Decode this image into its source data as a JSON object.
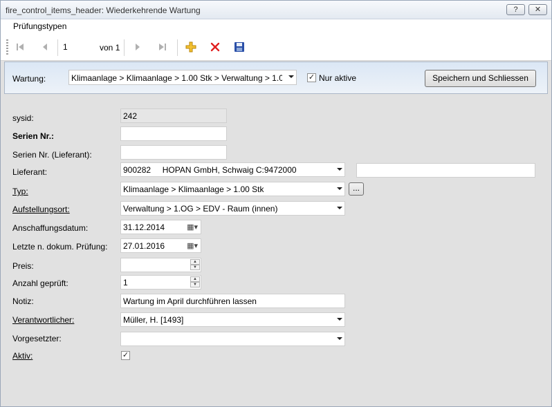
{
  "window": {
    "title": "fire_control_items_header: Wiederkehrende Wartung",
    "help_label": "?",
    "close_label": "✕"
  },
  "menu": {
    "items": [
      "Prüfungstypen"
    ]
  },
  "toolbar": {
    "page_value": "1",
    "of_label": "von",
    "total_pages": "1"
  },
  "filter": {
    "wartung_label": "Wartung:",
    "wartung_value": "Klimaanlage > Klimaanlage > 1.00 Stk > Verwaltung > 1.0",
    "nur_aktive_label": "Nur aktive",
    "nur_aktive_checked": true,
    "save_close_label": "Speichern und Schliessen"
  },
  "form": {
    "sysid": {
      "label": "sysid:",
      "value": "242"
    },
    "serien_nr": {
      "label": "Serien Nr.:",
      "value": ""
    },
    "serien_nr_lieferant": {
      "label": "Serien Nr. (Lieferant):",
      "value": ""
    },
    "lieferant": {
      "label": "Lieferant:",
      "value": "900282     HOPAN GmbH, Schwaig C:9472000",
      "extra": ""
    },
    "typ": {
      "label": "Typ:",
      "value": "Klimaanlage > Klimaanlage > 1.00 Stk",
      "button": "..."
    },
    "aufstellungsort": {
      "label": "Aufstellungsort:",
      "value": "Verwaltung > 1.OG > EDV - Raum (innen)"
    },
    "anschaffungsdatum": {
      "label": "Anschaffungsdatum:",
      "value": "31.12.2014"
    },
    "letzte_pruefung": {
      "label": "Letzte n. dokum. Prüfung:",
      "value": "27.01.2016"
    },
    "preis": {
      "label": "Preis:",
      "value": ""
    },
    "anzahl_geprueft": {
      "label": "Anzahl geprüft:",
      "value": "1"
    },
    "notiz": {
      "label": "Notiz:",
      "value": "Wartung im April durchführen lassen"
    },
    "verantwortlicher": {
      "label": "Verantwortlicher:",
      "value": "Müller, H. [1493]"
    },
    "vorgesetzter": {
      "label": "Vorgesetzter:",
      "value": ""
    },
    "aktiv": {
      "label": "Aktiv:",
      "checked": true
    }
  }
}
